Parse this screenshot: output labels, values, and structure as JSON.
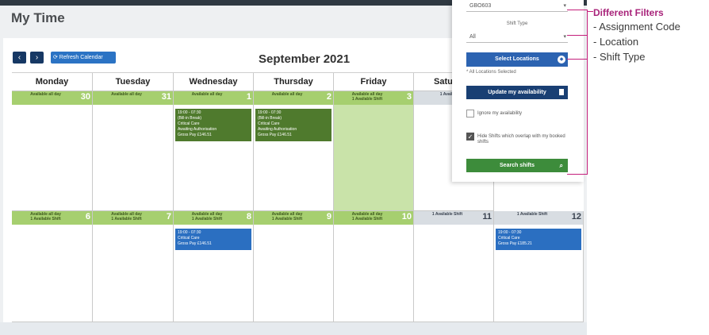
{
  "header": {
    "title": "My Time"
  },
  "toolbar": {
    "prev_label": "‹",
    "next_label": "›",
    "refresh_label": "⟳ Refresh Calendar",
    "month_label": "September 2021"
  },
  "calendar": {
    "days": [
      "Monday",
      "Tuesday",
      "Wednesday",
      "Thursday",
      "Friday",
      "Satu"
    ],
    "week1": [
      {
        "date": "30",
        "text": "Available all day"
      },
      {
        "date": "31",
        "text": "Available all day"
      },
      {
        "date": "1",
        "text": "Available all day"
      },
      {
        "date": "2",
        "text": "Available all day"
      },
      {
        "date": "3",
        "text": "Available all day\n1 Available Shift"
      },
      {
        "date": "",
        "text": "1 Availa"
      }
    ],
    "week2": [
      {
        "date": "6",
        "text": "Available all day\n1 Available Shift"
      },
      {
        "date": "7",
        "text": "Available all day\n1 Available Shift"
      },
      {
        "date": "8",
        "text": "Available all day\n1 Available Shift"
      },
      {
        "date": "9",
        "text": "Available all day\n1 Available Shift"
      },
      {
        "date": "10",
        "text": "Available all day\n1 Available Shift"
      },
      {
        "date": "11",
        "text": "1 Available Shift"
      },
      {
        "date": "12",
        "text": "1 Available Shift"
      }
    ],
    "shift_wed": "19:00 - 07:30\n(Bill-in Break)\nCritical Care\nAwaiting Authorisation\nGross Pay £146.51",
    "shift_thu": "19:00 - 07:30\n(Bill-in Break)\nCritical Care\nAwaiting Authorisation\nGross Pay £146.51",
    "shift_wed2": "19:00 - 07:30\nCritical Care\nGross Pay £146.51",
    "shift_sun": "19:00 - 07:30\nCritical Care\nGross Pay £185.21"
  },
  "filter": {
    "assignment_code": "GBO603",
    "shift_type_label": "Shift Type",
    "shift_type_value": "All",
    "select_locations": "Select Locations",
    "all_locations": "* All Locations Selected",
    "update_availability": "Update my availability",
    "ignore_availability": "Ignore my availability",
    "hide_overlap": "Hide Shifts which overlap with my booked shifts",
    "search": "Search shifts"
  },
  "annotation": {
    "title": "Different Filters",
    "items": [
      "- Assignment Code",
      "- Location",
      "- Shift Type"
    ]
  },
  "colors": {
    "accent": "#c41f7b",
    "available": "#a6cf6f",
    "booked": "#4f7a2d",
    "open_shift": "#2b6fc1"
  }
}
